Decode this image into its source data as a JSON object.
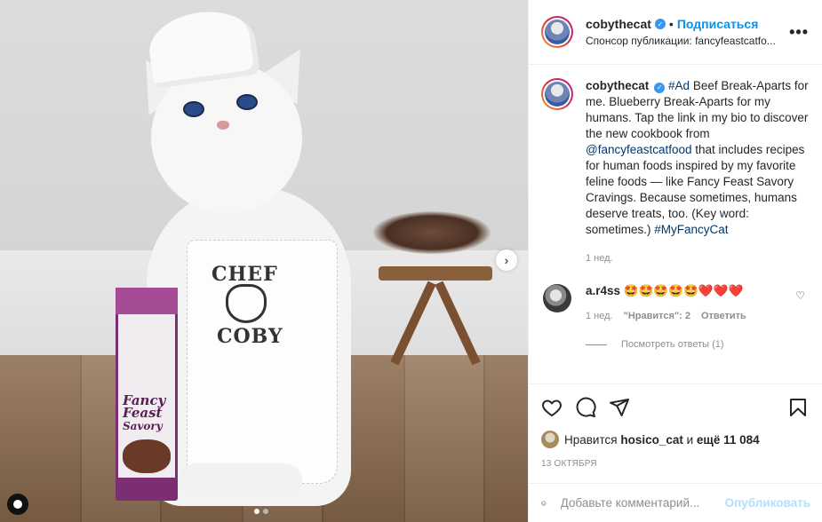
{
  "post": {
    "username": "cobythecat",
    "follow_label": "Подписаться",
    "separator": "•",
    "sponsor_text": "Спонсор публикации: fancyfeastcatfo...",
    "more_icon": "•••"
  },
  "caption": {
    "username": "cobythecat",
    "part1": "#Ad",
    "part2": " Beef Break-Aparts for me. Blueberry Break-Aparts for my humans. Tap the link in my bio to discover the new cookbook from ",
    "mention": "@fancyfeastcatfood",
    "part3": " that includes recipes for human foods inspired by my favorite feline foods — like Fancy Feast Savory Cravings. Because sometimes, humans deserve treats, too. (Key word: sometimes.) ",
    "hashtag": "#MyFancyCat",
    "time": "1 нед."
  },
  "comment": {
    "username": "a.r4ss",
    "text": "🤩🤩🤩🤩🤩❤️❤️❤️",
    "time": "1 нед.",
    "likes": "\"Нравится\": 2",
    "reply": "Ответить"
  },
  "view_replies": "Посмотреть ответы (1)",
  "likes": {
    "prefix": "Нравится ",
    "user": "hosico_cat",
    "middle": " и ",
    "rest": "ещё 11 084"
  },
  "date": "13 ОКТЯБРЯ",
  "add_comment": {
    "placeholder": "Добавьте комментарий...",
    "publish": "Опубликовать"
  },
  "media": {
    "apron_line1": "CHEF",
    "apron_line2": "COBY",
    "box_brand": "Fancy Feast",
    "box_sub": "Savory",
    "carousel_next": "›"
  },
  "colors": {
    "accent": "#0095f6",
    "link": "#00376b",
    "muted": "#8e8e8e",
    "publish_disabled": "#b2dffc"
  }
}
